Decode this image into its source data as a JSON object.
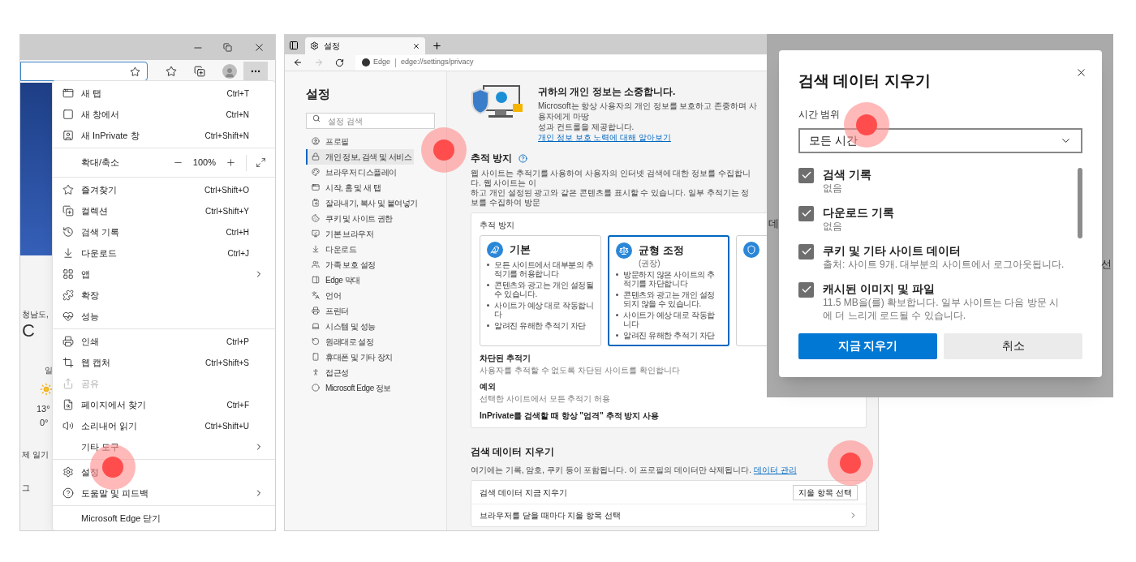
{
  "browser_window": {
    "background_texts": [
      "청남도,",
      "C",
      "일",
      "13°",
      "0°",
      "제 일기",
      "그"
    ],
    "menu": [
      {
        "kind": "item",
        "label": "새 탭",
        "shortcut": "Ctrl+T",
        "submenu": false,
        "disabled": false
      },
      {
        "kind": "item",
        "label": "새 창에서",
        "shortcut": "Ctrl+N",
        "submenu": false,
        "disabled": false
      },
      {
        "kind": "item",
        "label": "새 InPrivate 창",
        "shortcut": "Ctrl+Shift+N",
        "submenu": false,
        "disabled": false
      },
      {
        "kind": "separator"
      },
      {
        "kind": "zoom",
        "label": "확대/축소",
        "value": "100%"
      },
      {
        "kind": "separator"
      },
      {
        "kind": "item",
        "label": "즐겨찾기",
        "shortcut": "Ctrl+Shift+O",
        "submenu": false,
        "disabled": false
      },
      {
        "kind": "item",
        "label": "컬렉션",
        "shortcut": "Ctrl+Shift+Y",
        "submenu": false,
        "disabled": false
      },
      {
        "kind": "item",
        "label": "검색 기록",
        "shortcut": "Ctrl+H",
        "submenu": false,
        "disabled": false
      },
      {
        "kind": "item",
        "label": "다운로드",
        "shortcut": "Ctrl+J",
        "submenu": false,
        "disabled": false
      },
      {
        "kind": "item",
        "label": "앱",
        "submenu": true,
        "disabled": false
      },
      {
        "kind": "item",
        "label": "확장",
        "submenu": false,
        "disabled": false
      },
      {
        "kind": "item",
        "label": "성능",
        "submenu": false,
        "disabled": false
      },
      {
        "kind": "separator"
      },
      {
        "kind": "item",
        "label": "인쇄",
        "shortcut": "Ctrl+P",
        "submenu": false,
        "disabled": false
      },
      {
        "kind": "item",
        "label": "웹 캡처",
        "shortcut": "Ctrl+Shift+S",
        "submenu": false,
        "disabled": false
      },
      {
        "kind": "item",
        "label": "공유",
        "submenu": false,
        "disabled": true
      },
      {
        "kind": "item",
        "label": "페이지에서 찾기",
        "shortcut": "Ctrl+F",
        "submenu": false,
        "disabled": false
      },
      {
        "kind": "item",
        "label": "소리내어 읽기",
        "shortcut": "Ctrl+Shift+U",
        "submenu": false,
        "disabled": false
      },
      {
        "kind": "item",
        "label": "기타 도구",
        "submenu": true,
        "disabled": false
      },
      {
        "kind": "separator"
      },
      {
        "kind": "item",
        "label": "설정",
        "submenu": false,
        "disabled": false
      },
      {
        "kind": "item",
        "label": "도움말 및 피드백",
        "submenu": true,
        "disabled": false
      },
      {
        "kind": "separator"
      },
      {
        "kind": "item",
        "label": "Microsoft Edge 닫기",
        "submenu": false,
        "disabled": false
      }
    ]
  },
  "settings_window": {
    "tab": {
      "title": "설정"
    },
    "address": {
      "site": "Edge",
      "url": "edge://settings/privacy"
    },
    "sidebar": {
      "title": "설정",
      "search_placeholder": "설정 검색",
      "items": [
        {
          "label": "프로필",
          "selected": false
        },
        {
          "label": "개인 정보, 검색 및 서비스",
          "selected": true
        },
        {
          "label": "브라우저 디스플레이",
          "selected": false
        },
        {
          "label": "시작, 홈 및 새 탭",
          "selected": false
        },
        {
          "label": "잘라내기, 복사 및 붙여넣기",
          "selected": false
        },
        {
          "label": "쿠키 및 사이트 권한",
          "selected": false
        },
        {
          "label": "기본 브라우저",
          "selected": false
        },
        {
          "label": "다운로드",
          "selected": false
        },
        {
          "label": "가족 보호 설정",
          "selected": false
        },
        {
          "label": "Edge 막대",
          "selected": false
        },
        {
          "label": "언어",
          "selected": false
        },
        {
          "label": "프린터",
          "selected": false
        },
        {
          "label": "시스템 및 성능",
          "selected": false
        },
        {
          "label": "원래대로 설정",
          "selected": false
        },
        {
          "label": "휴대폰 및 기타 장치",
          "selected": false
        },
        {
          "label": "접근성",
          "selected": false
        },
        {
          "label": "Microsoft Edge 정보",
          "selected": false
        }
      ]
    },
    "privacy_header": {
      "title": "귀하의 개인 정보는 소중합니다.",
      "line_1": "Microsoft는 항상 사용자의 개인 정보를 보호하고 존중하며 사용자에게 마땅",
      "line_2": "성과 컨트롤을 제공합니다.",
      "link": "개인 정보 보호 노력에 대해 알아보기"
    },
    "tracking": {
      "title": "추적 방지",
      "lines": [
        "웹 사이트는 추적기를 사용하여 사용자의 인터넷 검색에 대한 정보를 수집합니다. 웹 사이트는 이",
        "하고 개인 설정된 광고와 같은 콘텐츠를 표시할 수 있습니다. 일부 추적기는 정보를 수집하여 방문"
      ],
      "card_label": "추적 방지",
      "options": [
        {
          "title": "기본",
          "selected": false,
          "bullets": [
            "모든 사이트에서 대부분의 추적기를 허용합니다",
            "콘텐츠와 광고는 개인 설정될 수 있습니다.",
            "사이트가 예상 대로 작동합니다",
            "알려진 유해한 추적기 차단"
          ]
        },
        {
          "title": "균형 조정",
          "subtitle": "(권장)",
          "selected": true,
          "bullets": [
            "방문하지 않은 사이트의 추적기를 차단합니다",
            "콘텐츠와 광고는 개인 설정되지 않을 수 있습니다.",
            "사이트가 예상 대로 작동합니다",
            "알려진 유해한 추적기 차단"
          ]
        },
        {
          "selected": false
        }
      ],
      "blocked": {
        "title": "차단된 추적기",
        "text": "사용자를 추적할 수 없도록 차단된 사이트를 확인합니다"
      },
      "exceptions": {
        "title": "예외",
        "text": "선택한 사이트에서 모든 추적기 허용"
      },
      "inprivate": "InPrivate를 검색할 때 항상 \"엄격\" 추적 방지 사용"
    },
    "clear_data": {
      "title": "검색 데이터 지우기",
      "text": "여기에는 기록, 암호, 쿠키 등이 포함됩니다. 이 프로필의 데이터만 삭제됩니다.",
      "link": "데이터 관리",
      "rows": [
        {
          "kind": "button",
          "label": "검색 데이터 지금 지우기",
          "button": "지울 항목 선택"
        },
        {
          "kind": "link",
          "label": "브라우저를 닫을 때마다 지울 항목 선택"
        }
      ]
    }
  },
  "dialog": {
    "backdrop_texts": [
      "데",
      "선"
    ],
    "title": "검색 데이터 지우기",
    "time_range": {
      "label": "시간 범위",
      "value": "모든 시간"
    },
    "items": [
      {
        "label": "검색 기록",
        "detail": "없음",
        "checked": true
      },
      {
        "label": "다운로드 기록",
        "detail": "없음",
        "checked": true
      },
      {
        "label": "쿠키 및 기타 사이트 데이터",
        "detail": "출처: 사이트 9개. 대부분의 사이트에서 로그아웃됩니다.",
        "checked": true
      },
      {
        "label": "캐시된 이미지 및 파일",
        "detail": "11.5 MB을(를) 확보합니다. 일부 사이트는 다음 방문 시에 더 느리게 로드될 수 있습니다.",
        "checked": true
      }
    ],
    "buttons": [
      {
        "kind": "primary",
        "label": "지금 지우기"
      },
      {
        "kind": "secondary",
        "label": "취소"
      }
    ]
  }
}
